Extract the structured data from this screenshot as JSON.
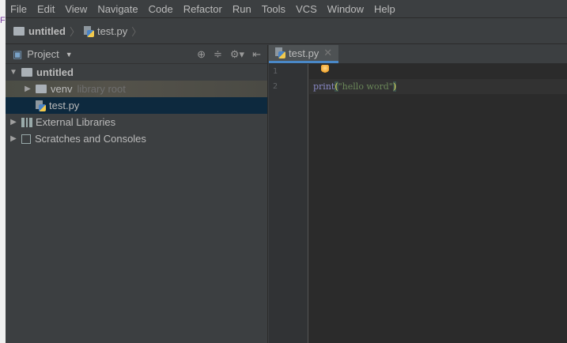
{
  "menu": [
    "File",
    "Edit",
    "View",
    "Navigate",
    "Code",
    "Refactor",
    "Run",
    "Tools",
    "VCS",
    "Window",
    "Help"
  ],
  "strip_letter": "F",
  "breadcrumb": {
    "project": "untitled",
    "file": "test.py"
  },
  "project_panel": {
    "title": "Project",
    "tree": {
      "root": "untitled",
      "venv": "venv",
      "venv_hint": "library root",
      "file": "test.py",
      "external": "External Libraries",
      "scratches": "Scratches and Consoles"
    }
  },
  "editor": {
    "tab": "test.py",
    "lines": [
      "1",
      "2"
    ],
    "code": {
      "fn": "print",
      "open": "(",
      "str": "\"hello word\"",
      "close": ")"
    }
  }
}
